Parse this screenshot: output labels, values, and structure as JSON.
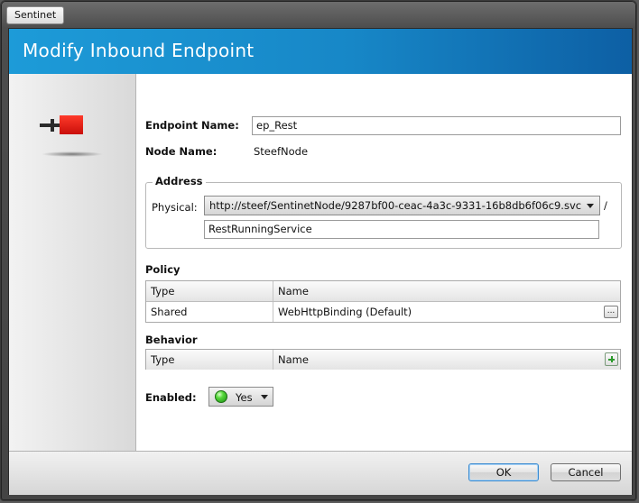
{
  "window": {
    "title": "Sentinet"
  },
  "dialog": {
    "header_title": "Modify Inbound Endpoint",
    "endpoint_icon": "endpoint-connector-icon"
  },
  "form": {
    "endpoint_name_label": "Endpoint Name:",
    "endpoint_name_value": "ep_Rest",
    "node_name_label": "Node Name:",
    "node_name_value": "SteefNode",
    "address": {
      "title": "Address",
      "physical_label": "Physical:",
      "physical_base_value": "http://steef/SentinetNode/9287bf00-ceac-4a3c-9331-16b8db6f06c9.svc",
      "separator": "/",
      "path_value": "RestRunningService"
    },
    "policy": {
      "title": "Policy",
      "columns": [
        "Type",
        "Name"
      ],
      "rows": [
        {
          "type": "Shared",
          "name": "WebHttpBinding (Default)",
          "action_label": "..."
        }
      ]
    },
    "behavior": {
      "title": "Behavior",
      "columns": [
        "Type",
        "Name"
      ],
      "rows": []
    },
    "enabled": {
      "label": "Enabled:",
      "value": "Yes",
      "status_color": "#3fc42a"
    }
  },
  "footer": {
    "ok_label": "OK",
    "cancel_label": "Cancel"
  },
  "colors": {
    "header_blue": "#1787c7",
    "accent_red": "#e8221b"
  }
}
